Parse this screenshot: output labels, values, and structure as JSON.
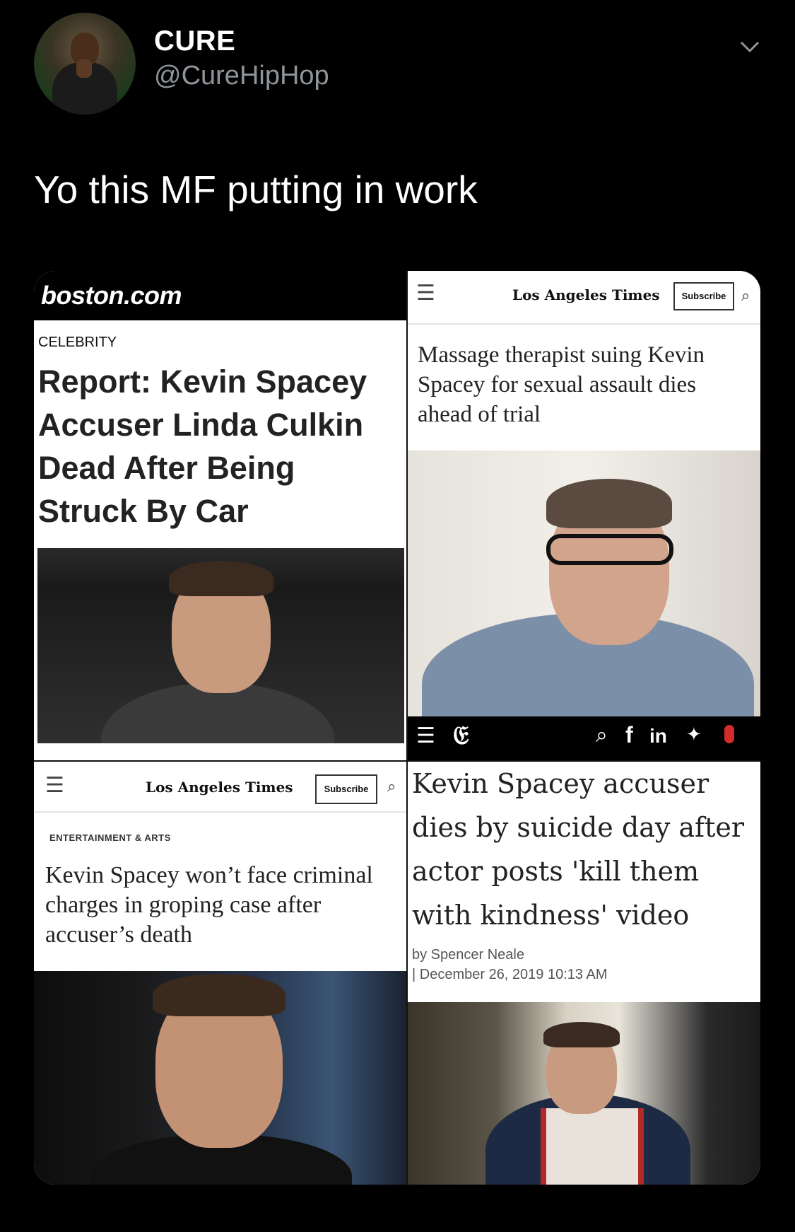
{
  "tweet": {
    "display_name": "CURE",
    "handle": "@CureHipHop",
    "text": "Yo this MF putting in work"
  },
  "panels": {
    "boston": {
      "logo": "boston.com",
      "section": "CELEBRITY",
      "headline": "Report: Kevin Spacey Accuser Linda Culkin Dead After Being Struck By Car"
    },
    "lat_top": {
      "logo": "Los Angeles Times",
      "subscribe": "Subscribe",
      "headline": "Massage therapist suing Kevin Spacey for sexual assault dies ahead of trial"
    },
    "lat_bottom": {
      "logo": "Los Angeles Times",
      "subscribe": "Subscribe",
      "section": "ENTERTAINMENT & ARTS",
      "headline": "Kevin Spacey won’t face criminal charges in groping case after accuser’s death"
    },
    "independent": {
      "masthead_glyph": "𝔈",
      "social_icons": [
        "search-icon",
        "facebook-icon",
        "linkedin-icon",
        "twitter-icon",
        "microphone-icon"
      ],
      "headline": "Kevin Spacey accuser dies by suicide day after actor posts 'kill them with kindness' video",
      "byline": "by Spencer Neale",
      "date": "| December 26, 2019 10:13 AM"
    }
  }
}
